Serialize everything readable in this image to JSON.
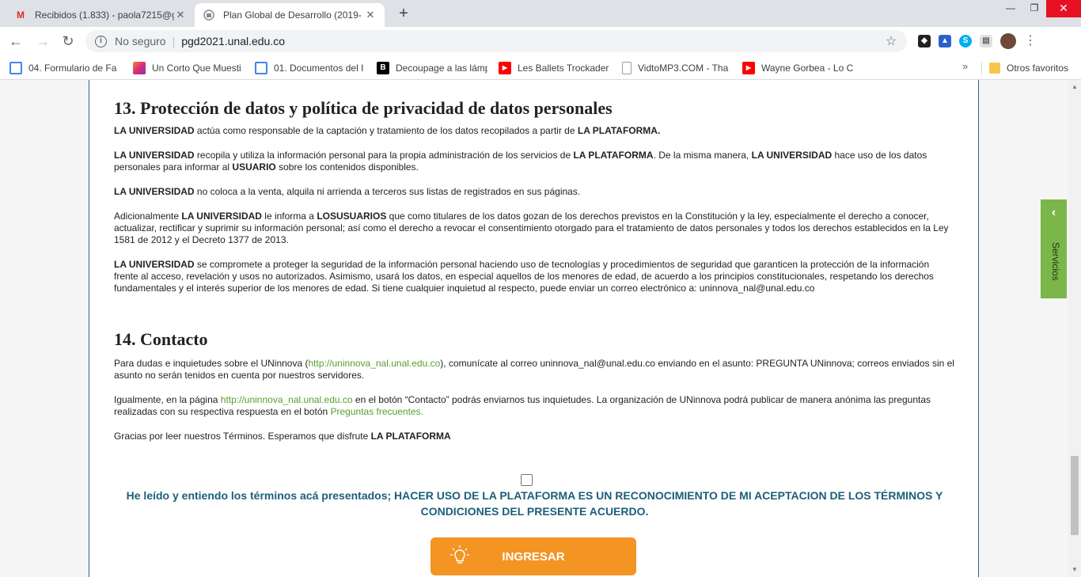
{
  "browser": {
    "tabs": [
      {
        "title": "Recibidos (1.833) - paola7215@g",
        "icon": "gmail-icon",
        "active": false
      },
      {
        "title": "Plan Global de Desarrollo (2019-",
        "icon": "unal-icon",
        "active": true
      }
    ],
    "new_tab": "+",
    "window_controls": {
      "minimize": "—",
      "maximize": "❐",
      "close": "✕"
    },
    "nav": {
      "back": "←",
      "forward": "→",
      "reload": "↻"
    },
    "omnibox": {
      "security": "No seguro",
      "separator": "|",
      "url": "pgd2021.unal.edu.co",
      "star": "☆"
    },
    "menu": "⋮"
  },
  "bookmarks": [
    {
      "label": "04. Formulario de Fa",
      "icon": "docs-icon",
      "color": "#4285f4"
    },
    {
      "label": "Un Corto Que Muesti",
      "icon": "instagram-icon",
      "color": "#e1306c"
    },
    {
      "label": "01. Documentos del I",
      "icon": "docs-icon",
      "color": "#4285f4"
    },
    {
      "label": "Decoupage a las lámp",
      "icon": "b-icon",
      "color": "#000000"
    },
    {
      "label": "Les Ballets Trockader",
      "icon": "youtube-icon",
      "color": "#ff0000"
    },
    {
      "label": "VidtoMP3.COM - Tha",
      "icon": "page-icon",
      "color": "#9e9e9e"
    },
    {
      "label": "Wayne Gorbea - Lo C",
      "icon": "youtube-icon",
      "color": "#ff0000"
    }
  ],
  "bookmarks_more": "»",
  "bookmarks_folder": "Otros favoritos",
  "section13": {
    "title": "13. Protección de datos y política de privacidad de datos personales",
    "p1": {
      "a": "LA UNIVERSIDAD",
      "b": " actúa como responsable de la captación y tratamiento de los datos recopilados a partir de ",
      "c": "LA PLATAFORMA."
    },
    "p2": {
      "a": "LA UNIVERSIDAD",
      "b": " recopila y utiliza la información personal para la propia administración de los servicios de ",
      "c": "LA PLATAFORMA",
      "d": ". De la misma manera, ",
      "e": "LA UNIVERSIDAD",
      "f": " hace uso de los datos personales para informar al ",
      "g": "USUARIO",
      "h": " sobre los contenidos disponibles."
    },
    "p3": {
      "a": "LA UNIVERSIDAD",
      "b": " no coloca a la venta, alquila ni arrienda a terceros sus listas de registrados en sus páginas."
    },
    "p4": {
      "a": "Adicionalmente ",
      "b": "LA UNIVERSIDAD",
      "c": " le informa a ",
      "d": "LOSUSUARIOS",
      "e": " que como titulares de los datos gozan de los derechos previstos en la Constitución y la ley, especialmente el derecho a conocer, actualizar, rectificar y suprimir su información personal; así como el derecho a revocar el consentimiento otorgado para el tratamiento de datos personales y todos los derechos establecidos en la Ley 1581 de 2012 y el Decreto 1377 de 2013."
    },
    "p5": {
      "a": "LA UNIVERSIDAD",
      "b": " se compromete a proteger la seguridad de la información personal haciendo uso de tecnologías y procedimientos de seguridad que garanticen la protección de la información frente al acceso, revelación y usos no autorizados. Asimismo, usará los datos, en especial aquellos de los menores de edad, de acuerdo a los principios constitucionales, respetando los derechos fundamentales y el interés superior de los menores de edad. Si tiene cualquier inquietud al respecto, puede enviar un correo electrónico a: uninnova_nal@unal.edu.co"
    }
  },
  "section14": {
    "title": "14. Contacto",
    "p1": {
      "a": "Para dudas e inquietudes sobre el UNinnova (",
      "link": "http://uninnova_nal.unal.edu.co",
      "b": "), comunícate al correo uninnova_nal@unal.edu.co enviando en el asunto: PREGUNTA UNinnova; correos enviados sin el asunto no serán tenidos en cuenta por nuestros servidores."
    },
    "p2": {
      "a": "Igualmente, en la página ",
      "link": "http://uninnova_nal.unal.edu.co",
      "b": " en el botón “Contacto” podrás enviarnos tus inquietudes. La organización de UNinnova podrá publicar de manera anónima las preguntas realizadas con su respectiva respuesta en el botón ",
      "link2": "Preguntas frecuentes."
    },
    "p3": {
      "a": "Gracias por leer nuestros Términos. Esperamos que disfrute ",
      "b": "LA PLATAFORMA"
    }
  },
  "acceptance": {
    "checked": false,
    "text": "He leído y entiendo los términos acá presentados; HACER USO DE LA PLATAFORMA ES UN RECONOCIMIENTO DE MI ACEPTACION DE LOS TÉRMINOS Y CONDICIONES DEL PRESENTE ACUERDO."
  },
  "submit_button": {
    "label": "INGRESAR",
    "color": "#f39423"
  },
  "side_tab": {
    "label": "Servicios",
    "arrow": "‹",
    "color": "#7ab648"
  },
  "colors": {
    "heading_blue": "#1b5f7a",
    "link_green": "#5b9e2d",
    "card_border": "#2b5f88"
  }
}
